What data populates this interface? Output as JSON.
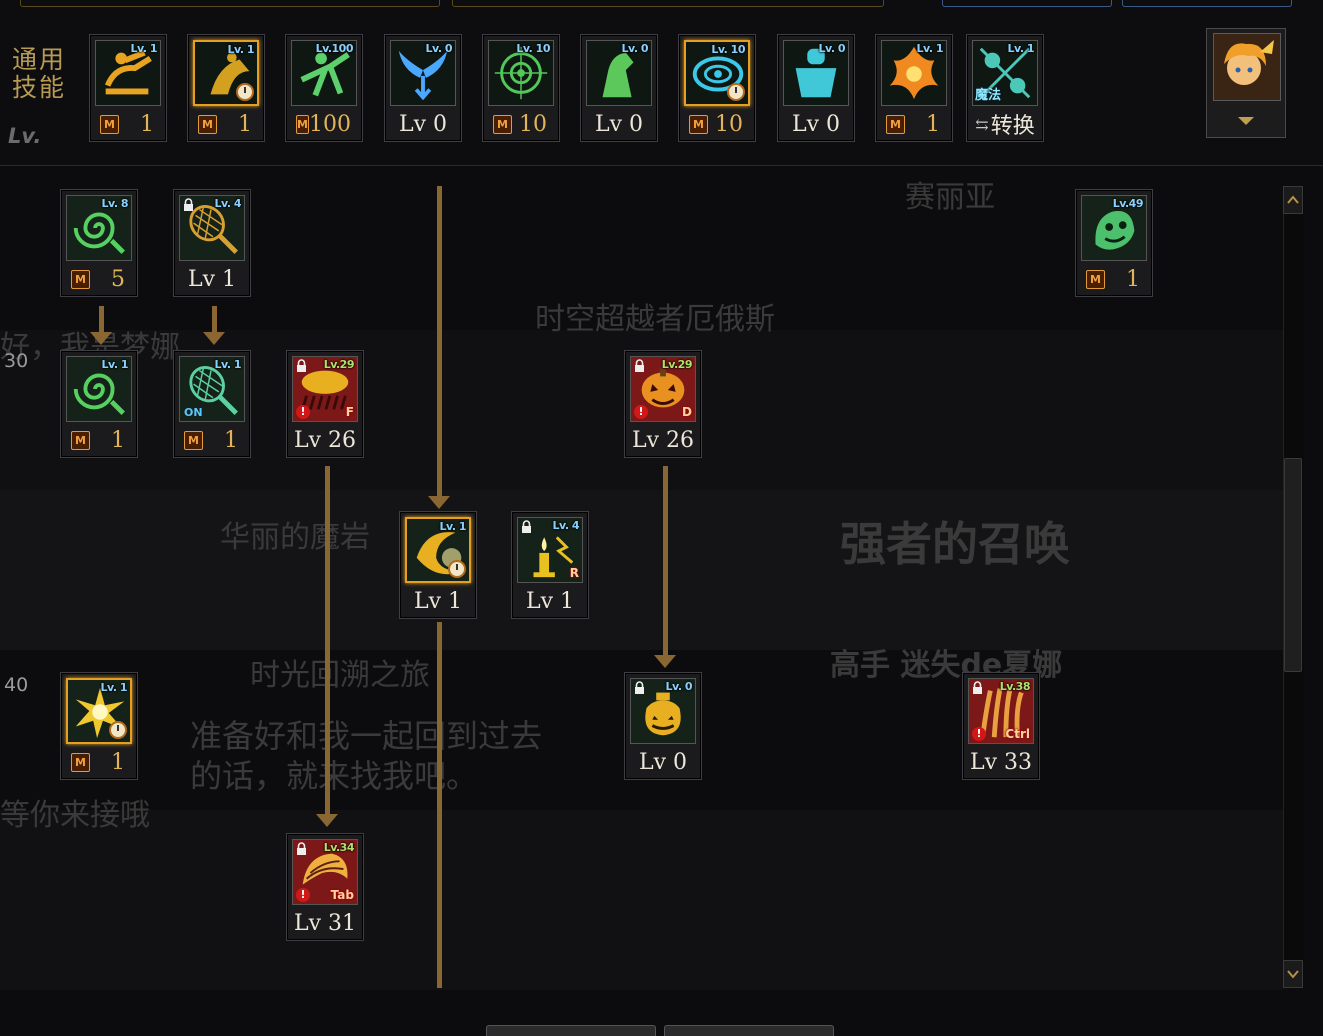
{
  "header": {
    "category_label": "通用\n技能",
    "lv_label": "Lv."
  },
  "top_skills": [
    {
      "id": "top-1",
      "lv_tag": "Lv. 1",
      "bottom": "1",
      "mastery": true,
      "selected": false,
      "color": "#e8a420"
    },
    {
      "id": "top-2",
      "lv_tag": "Lv. 1",
      "bottom": "1",
      "mastery": true,
      "selected": true,
      "cooldown": true,
      "color": "#d4a020"
    },
    {
      "id": "top-3",
      "lv_tag": "Lv.100",
      "bottom": "100",
      "mastery": true,
      "selected": false,
      "color": "#5cd06c"
    },
    {
      "id": "top-4",
      "lv_tag": "Lv. 0",
      "bottom": "Lv 0",
      "mastery": false,
      "selected": false,
      "color": "#4aa8ff"
    },
    {
      "id": "top-5",
      "lv_tag": "Lv. 10",
      "bottom": "10",
      "mastery": true,
      "selected": false,
      "color": "#52c85a"
    },
    {
      "id": "top-6",
      "lv_tag": "Lv. 0",
      "bottom": "Lv 0",
      "mastery": false,
      "selected": false,
      "color": "#5cc85c"
    },
    {
      "id": "top-7",
      "lv_tag": "Lv. 10",
      "bottom": "10",
      "mastery": true,
      "selected": true,
      "cooldown": true,
      "color": "#3cc8e8"
    },
    {
      "id": "top-8",
      "lv_tag": "Lv. 0",
      "bottom": "Lv 0",
      "mastery": false,
      "selected": false,
      "color": "#40c8d8"
    },
    {
      "id": "top-9",
      "lv_tag": "Lv. 1",
      "bottom": "1",
      "mastery": true,
      "selected": false,
      "color": "#f08a20"
    },
    {
      "id": "top-10",
      "lv_tag": "Lv. 1",
      "bottom": "转换",
      "mastery": false,
      "conversion": true,
      "magic_tag": "魔法",
      "selected": false,
      "color": "#4cc8b8"
    }
  ],
  "tree_skills": [
    {
      "id": "s-swirl",
      "lv_tag": "Lv. 8",
      "bottom": "5",
      "mastery": true,
      "color": "#56d060",
      "glyph": "swirl"
    },
    {
      "id": "s-net",
      "lv_tag": "Lv. 4",
      "bottom": "Lv 1",
      "locked": true,
      "color": "#d8a030",
      "glyph": "net"
    },
    {
      "id": "s-ghost",
      "lv_tag": "Lv.49",
      "bottom": "1",
      "mastery": true,
      "color": "#4cc06c",
      "glyph": "ghost"
    },
    {
      "id": "s-swirl2",
      "lv_tag": "Lv. 1",
      "bottom": "1",
      "mastery": true,
      "color": "#56d060",
      "glyph": "swirl"
    },
    {
      "id": "s-net2",
      "lv_tag": "Lv. 1",
      "bottom": "1",
      "mastery": true,
      "on_tag": "ON",
      "color": "#5cd0a0",
      "glyph": "net"
    },
    {
      "id": "s-rain",
      "lv_tag": "Lv.29",
      "bottom": "Lv 26",
      "locked": true,
      "warn": true,
      "hotkey": "F",
      "red": true,
      "color": "#e8b020",
      "glyph": "cloud"
    },
    {
      "id": "s-pumpkin",
      "lv_tag": "Lv.29",
      "bottom": "Lv 26",
      "locked": true,
      "warn": true,
      "hotkey": "D",
      "red": true,
      "color": "#e89020",
      "glyph": "pumpkin"
    },
    {
      "id": "s-crescent",
      "lv_tag": "Lv. 1",
      "bottom": "Lv 1",
      "selected": true,
      "cooldown": true,
      "color": "#e8b020",
      "glyph": "crescent"
    },
    {
      "id": "s-candle",
      "lv_tag": "Lv. 4",
      "bottom": "Lv 1",
      "locked": true,
      "hotkey": "R",
      "color": "#e8c020",
      "glyph": "candle"
    },
    {
      "id": "s-burst",
      "lv_tag": "Lv. 1",
      "bottom": "1",
      "mastery": true,
      "selected": true,
      "cooldown": true,
      "color": "#f0c830",
      "glyph": "burst"
    },
    {
      "id": "s-sack",
      "lv_tag": "Lv. 0",
      "bottom": "Lv 0",
      "locked": true,
      "color": "#e8b020",
      "glyph": "sack"
    },
    {
      "id": "s-claws",
      "lv_tag": "Lv.38",
      "bottom": "Lv 33",
      "locked": true,
      "warn": true,
      "hotkey": "Ctrl",
      "red": true,
      "color": "#e8a040",
      "glyph": "claws"
    },
    {
      "id": "s-shell",
      "lv_tag": "Lv.34",
      "bottom": "Lv 31",
      "locked": true,
      "warn": true,
      "hotkey": "Tab",
      "red": true,
      "color": "#f0b040",
      "glyph": "shell"
    }
  ],
  "row_labels": [
    "30",
    "40"
  ],
  "background_text": {
    "name_1": "赛丽亚",
    "name_2": "时空超越者厄俄斯",
    "name_3": "华丽的魔岩",
    "name_4": "强者的召唤",
    "name_5": "高手 迷失de夏娜",
    "name_6": "时光回溯之旅",
    "dialog": "准备好和我一起回到过去的话，就来找我吧。",
    "left_1": "好，我是梦娜",
    "left_2": "等你来接哦"
  },
  "colors": {
    "connector": "#8a6632",
    "selected_border": "#e6a020",
    "mastery_text": "#e2b357",
    "background": "#0c0c0e"
  }
}
